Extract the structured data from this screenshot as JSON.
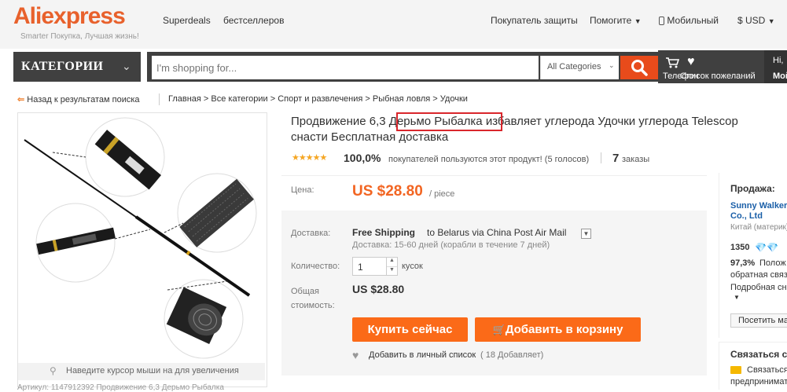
{
  "header": {
    "logo_ali": "Ali",
    "logo_express": "express",
    "tagline": "Smarter Покупка, Лучшая жизнь!",
    "nav": [
      "Superdeals",
      "бестселлеров"
    ],
    "right_links": [
      "Покупатель защиты",
      "Помогите",
      "Мобильный",
      "$ USD"
    ]
  },
  "search": {
    "category_label": "КАТЕГОРИИ",
    "placeholder": "I'm shopping for...",
    "all_categories": "All Categories",
    "cart_label": "Телефон",
    "wishlist_label": "Список пожеланий",
    "greeting": "Hi,",
    "account": "Мой"
  },
  "breadcrumb": {
    "back": "Назад к результатам поиска",
    "path": "Главная > Все категории > Спорт и развлечения > Рыбная ловля > Удочки"
  },
  "product": {
    "title_line1": "Продвижение 6,3 Дерьмо Рыбалка избавляет углерода Удочки углерода Telescop",
    "title_line2": "снасти Бесплатная доставка",
    "stars": "★★★★★",
    "rating": "100,0%",
    "rating_text": "покупателей пользуются этот продукт! (5 голосов)",
    "orders_count": "7",
    "orders_label": "заказы",
    "price_label": "Цена:",
    "price": "US $28.80",
    "price_unit": "/ piece",
    "shipping_label": "Доставка:",
    "shipping_value": "Free Shipping",
    "shipping_to": "to Belarus via China Post Air Mail",
    "shipping_eta": "Доставка: 15-60 дней (корабли в течение 7 дней)",
    "qty_label": "Количество:",
    "qty_value": "1",
    "qty_unit": "кусок",
    "total_label_1": "Общая",
    "total_label_2": "стоимость:",
    "total_value": "US $28.80",
    "buy_now": "Купить сейчас",
    "add_to_cart": "Добавить в корзину",
    "wishlist_add": "Добавить в личный список",
    "wishlist_count": "( 18 Добавляет)",
    "zoom_hint": "Наведите курсор мыши на для увеличения",
    "bottom_caption": "Артикул: 1147912392 Продвижение 6,3 Дерьмо Рыбалка"
  },
  "seller": {
    "heading": "Продажа:",
    "name_line1": "Sunny Walker",
    "name_line2": "Co., Ltd",
    "country": "Китай (материк)",
    "score": "1350",
    "feedback_pct": "97,3%",
    "feedback_text": "Полож",
    "feedback_line2": "обратная связ",
    "details": "Подробная сн",
    "visit_button": "Посетить ма",
    "contact_heading": "Связаться с",
    "contact_link_1": "Связаться с",
    "contact_link_2": "предпринимателем"
  },
  "colors": {
    "accent": "#e8612c",
    "search_btn": "#e84b1b",
    "button": "#fb6a18",
    "dark_bar": "#404040",
    "highlight_box": "#d9262c"
  }
}
